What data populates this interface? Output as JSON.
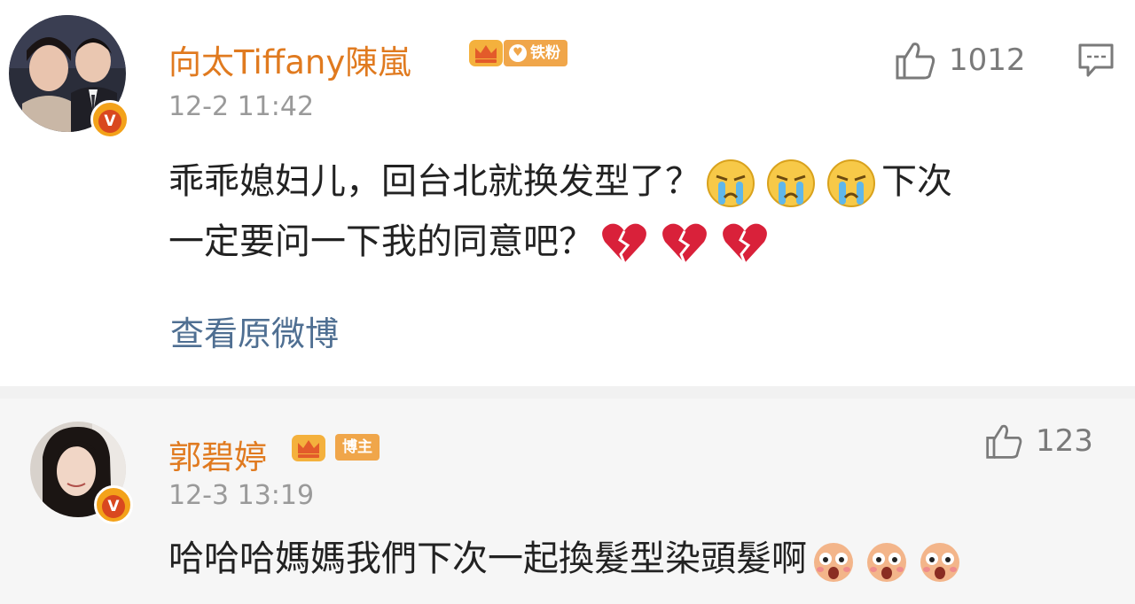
{
  "comments": [
    {
      "username": "向太Tiffany陳嵐",
      "fan_badge": "铁粉",
      "timestamp": "12-2 11:42",
      "likes": "1012",
      "text_line1": "乖乖媳妇儿，回台北就换发型了？",
      "text_line1_tail": "下次",
      "text_line2": "一定要问一下我的同意吧？",
      "view_original": "查看原微博",
      "emoji_line1": [
        "crying-emoji",
        "crying-emoji",
        "crying-emoji"
      ],
      "emoji_line2": [
        "broken-heart-emoji",
        "broken-heart-emoji",
        "broken-heart-emoji"
      ]
    },
    {
      "username": "郭碧婷",
      "fan_badge": "博主",
      "timestamp": "12-3 13:19",
      "likes": "123",
      "text_line1": "哈哈哈媽媽我們下次一起換髮型染頭髮啊",
      "emoji_line1": [
        "shocked-face-emoji",
        "shocked-face-emoji",
        "shocked-face-emoji"
      ]
    }
  ],
  "colors": {
    "username": "#e07a1f",
    "timestamp": "#9a9a9a",
    "link": "#4f6f92",
    "verified_badge": "#f3a21a"
  }
}
